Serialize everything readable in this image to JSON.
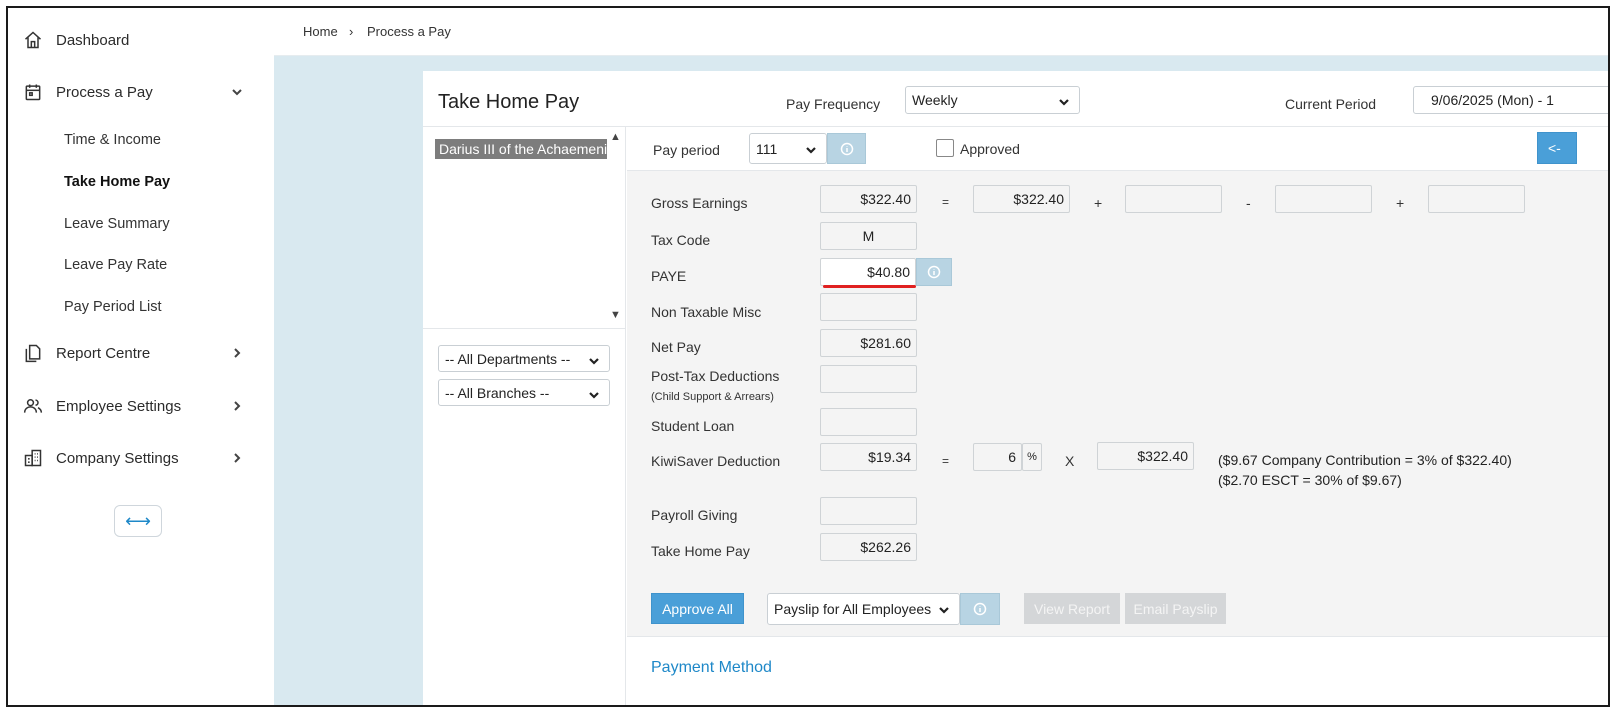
{
  "sidebar": {
    "items": [
      {
        "label": "Dashboard",
        "icon": "home-icon"
      },
      {
        "label": "Process a Pay",
        "icon": "calendar-icon"
      },
      {
        "label": "Report Centre",
        "icon": "documents-icon"
      },
      {
        "label": "Employee Settings",
        "icon": "users-icon"
      },
      {
        "label": "Company Settings",
        "icon": "building-icon"
      }
    ],
    "sub_items": [
      "Time & Income",
      "Take Home Pay",
      "Leave Summary",
      "Leave Pay Rate",
      "Pay Period List"
    ],
    "collapse_symbol": "⟷"
  },
  "breadcrumb": {
    "home": "Home",
    "separator": "›",
    "current": "Process a Pay"
  },
  "card": {
    "title": "Take Home Pay",
    "pay_frequency_label": "Pay Frequency",
    "pay_frequency_value": "Weekly",
    "current_period_label": "Current Period",
    "current_period_value": "9/06/2025 (Mon) - 1"
  },
  "employees": {
    "selected": "Darius III of the Achaemenid"
  },
  "filters": {
    "departments": "-- All Departments --",
    "branches": "-- All Branches --"
  },
  "pay_period": {
    "label": "Pay period",
    "value": "111",
    "approved_label": "Approved",
    "nav_button": "<-"
  },
  "rows": {
    "gross_earnings": {
      "label": "Gross Earnings",
      "value": "$322.40",
      "equals": "=",
      "component1": "$322.40",
      "plus1": "+",
      "component2": "",
      "minus": "-",
      "component3": "",
      "plus2": "+",
      "component4": ""
    },
    "tax_code": {
      "label": "Tax Code",
      "value": "M"
    },
    "paye": {
      "label": "PAYE",
      "value": "$40.80"
    },
    "non_taxable_misc": {
      "label": "Non Taxable Misc",
      "value": ""
    },
    "net_pay": {
      "label": "Net Pay",
      "value": "$281.60"
    },
    "post_tax": {
      "label": "Post-Tax Deductions",
      "sublabel": "(Child Support & Arrears)",
      "value": ""
    },
    "student_loan": {
      "label": "Student Loan",
      "value": ""
    },
    "kiwisaver": {
      "label": "KiwiSaver Deduction",
      "value": "$19.34",
      "equals": "=",
      "rate": "6",
      "pct": "%",
      "times": "X",
      "base": "$322.40",
      "note1": "($9.67 Company Contribution = 3% of $322.40)",
      "note2": "($2.70 ESCT = 30% of $9.67)"
    },
    "payroll_giving": {
      "label": "Payroll Giving",
      "value": ""
    },
    "take_home_pay": {
      "label": "Take Home Pay",
      "value": "$262.26"
    }
  },
  "actions": {
    "approve_all": "Approve All",
    "payslip_option": "Payslip for All Employees",
    "view_report": "View Report",
    "email_payslip": "Email Payslip"
  },
  "payment_method": "Payment Method",
  "colors": {
    "accent": "#1e88c8",
    "button_blue": "#4a9fd8",
    "highlight_underline": "#e02020",
    "content_bg": "#d9e9f0"
  }
}
